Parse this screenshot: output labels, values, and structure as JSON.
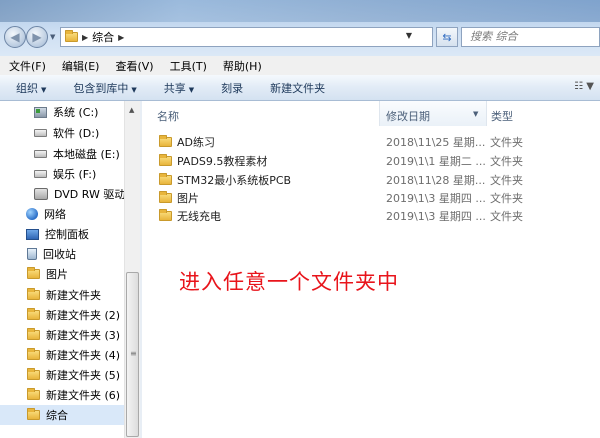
{
  "address": {
    "crumbs": [
      "综合"
    ],
    "search_placeholder": "搜索 综合"
  },
  "menu": [
    "文件(F)",
    "编辑(E)",
    "查看(V)",
    "工具(T)",
    "帮助(H)"
  ],
  "toolbar": {
    "organize": "组织",
    "include_in_library": "包含到库中",
    "share": "共享",
    "burn": "刻录",
    "new_folder": "新建文件夹"
  },
  "nav": [
    {
      "label": "系统 (C:)",
      "icon": "system-drive-icon"
    },
    {
      "label": "软件 (D:)",
      "icon": "drive-icon"
    },
    {
      "label": "本地磁盘 (E:)",
      "icon": "drive-icon"
    },
    {
      "label": "娱乐 (F:)",
      "icon": "drive-icon"
    },
    {
      "label": "DVD RW 驱动",
      "icon": "dvd-drive-icon"
    },
    {
      "label": "网络",
      "icon": "network-icon"
    },
    {
      "label": "控制面板",
      "icon": "control-panel-icon"
    },
    {
      "label": "回收站",
      "icon": "recycle-bin-icon"
    },
    {
      "label": "图片",
      "icon": "folder-icon"
    },
    {
      "label": "新建文件夹",
      "icon": "folder-icon"
    },
    {
      "label": "新建文件夹 (2)",
      "icon": "folder-icon"
    },
    {
      "label": "新建文件夹 (3)",
      "icon": "folder-icon"
    },
    {
      "label": "新建文件夹 (4)",
      "icon": "folder-icon"
    },
    {
      "label": "新建文件夹 (5)",
      "icon": "folder-icon"
    },
    {
      "label": "新建文件夹 (6)",
      "icon": "folder-icon"
    },
    {
      "label": "综合",
      "icon": "folder-icon",
      "selected": true
    }
  ],
  "columns": {
    "name": "名称",
    "date": "修改日期",
    "type": "类型"
  },
  "files": [
    {
      "name": "AD练习",
      "date": "2018\\11\\25 星期...",
      "type": "文件夹"
    },
    {
      "name": "PADS9.5教程素材",
      "date": "2019\\1\\1 星期二 ...",
      "type": "文件夹"
    },
    {
      "name": "STM32最小系统板PCB",
      "date": "2018\\11\\28 星期...",
      "type": "文件夹"
    },
    {
      "name": "图片",
      "date": "2019\\1\\3 星期四 ...",
      "type": "文件夹"
    },
    {
      "name": "无线充电",
      "date": "2019\\1\\3 星期四 ...",
      "type": "文件夹"
    }
  ],
  "annotation": "进入任意一个文件夹中",
  "colors": {
    "annotation": "#e8141b",
    "selection": "#d9e8f9"
  }
}
